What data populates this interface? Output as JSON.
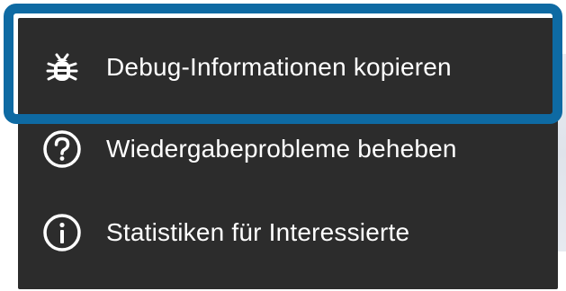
{
  "menu": {
    "items": [
      {
        "label": "Debug-Informationen kopieren",
        "icon": "bug-icon",
        "focused": true
      },
      {
        "label": "Wiedergabeprobleme beheben",
        "icon": "help-circle-icon"
      },
      {
        "label": "Statistiken für Interessierte",
        "icon": "info-circle-icon"
      }
    ]
  },
  "colors": {
    "menu_background": "#2c2c2c",
    "text": "#ffffff",
    "focus_ring": "#0e6aa3"
  }
}
